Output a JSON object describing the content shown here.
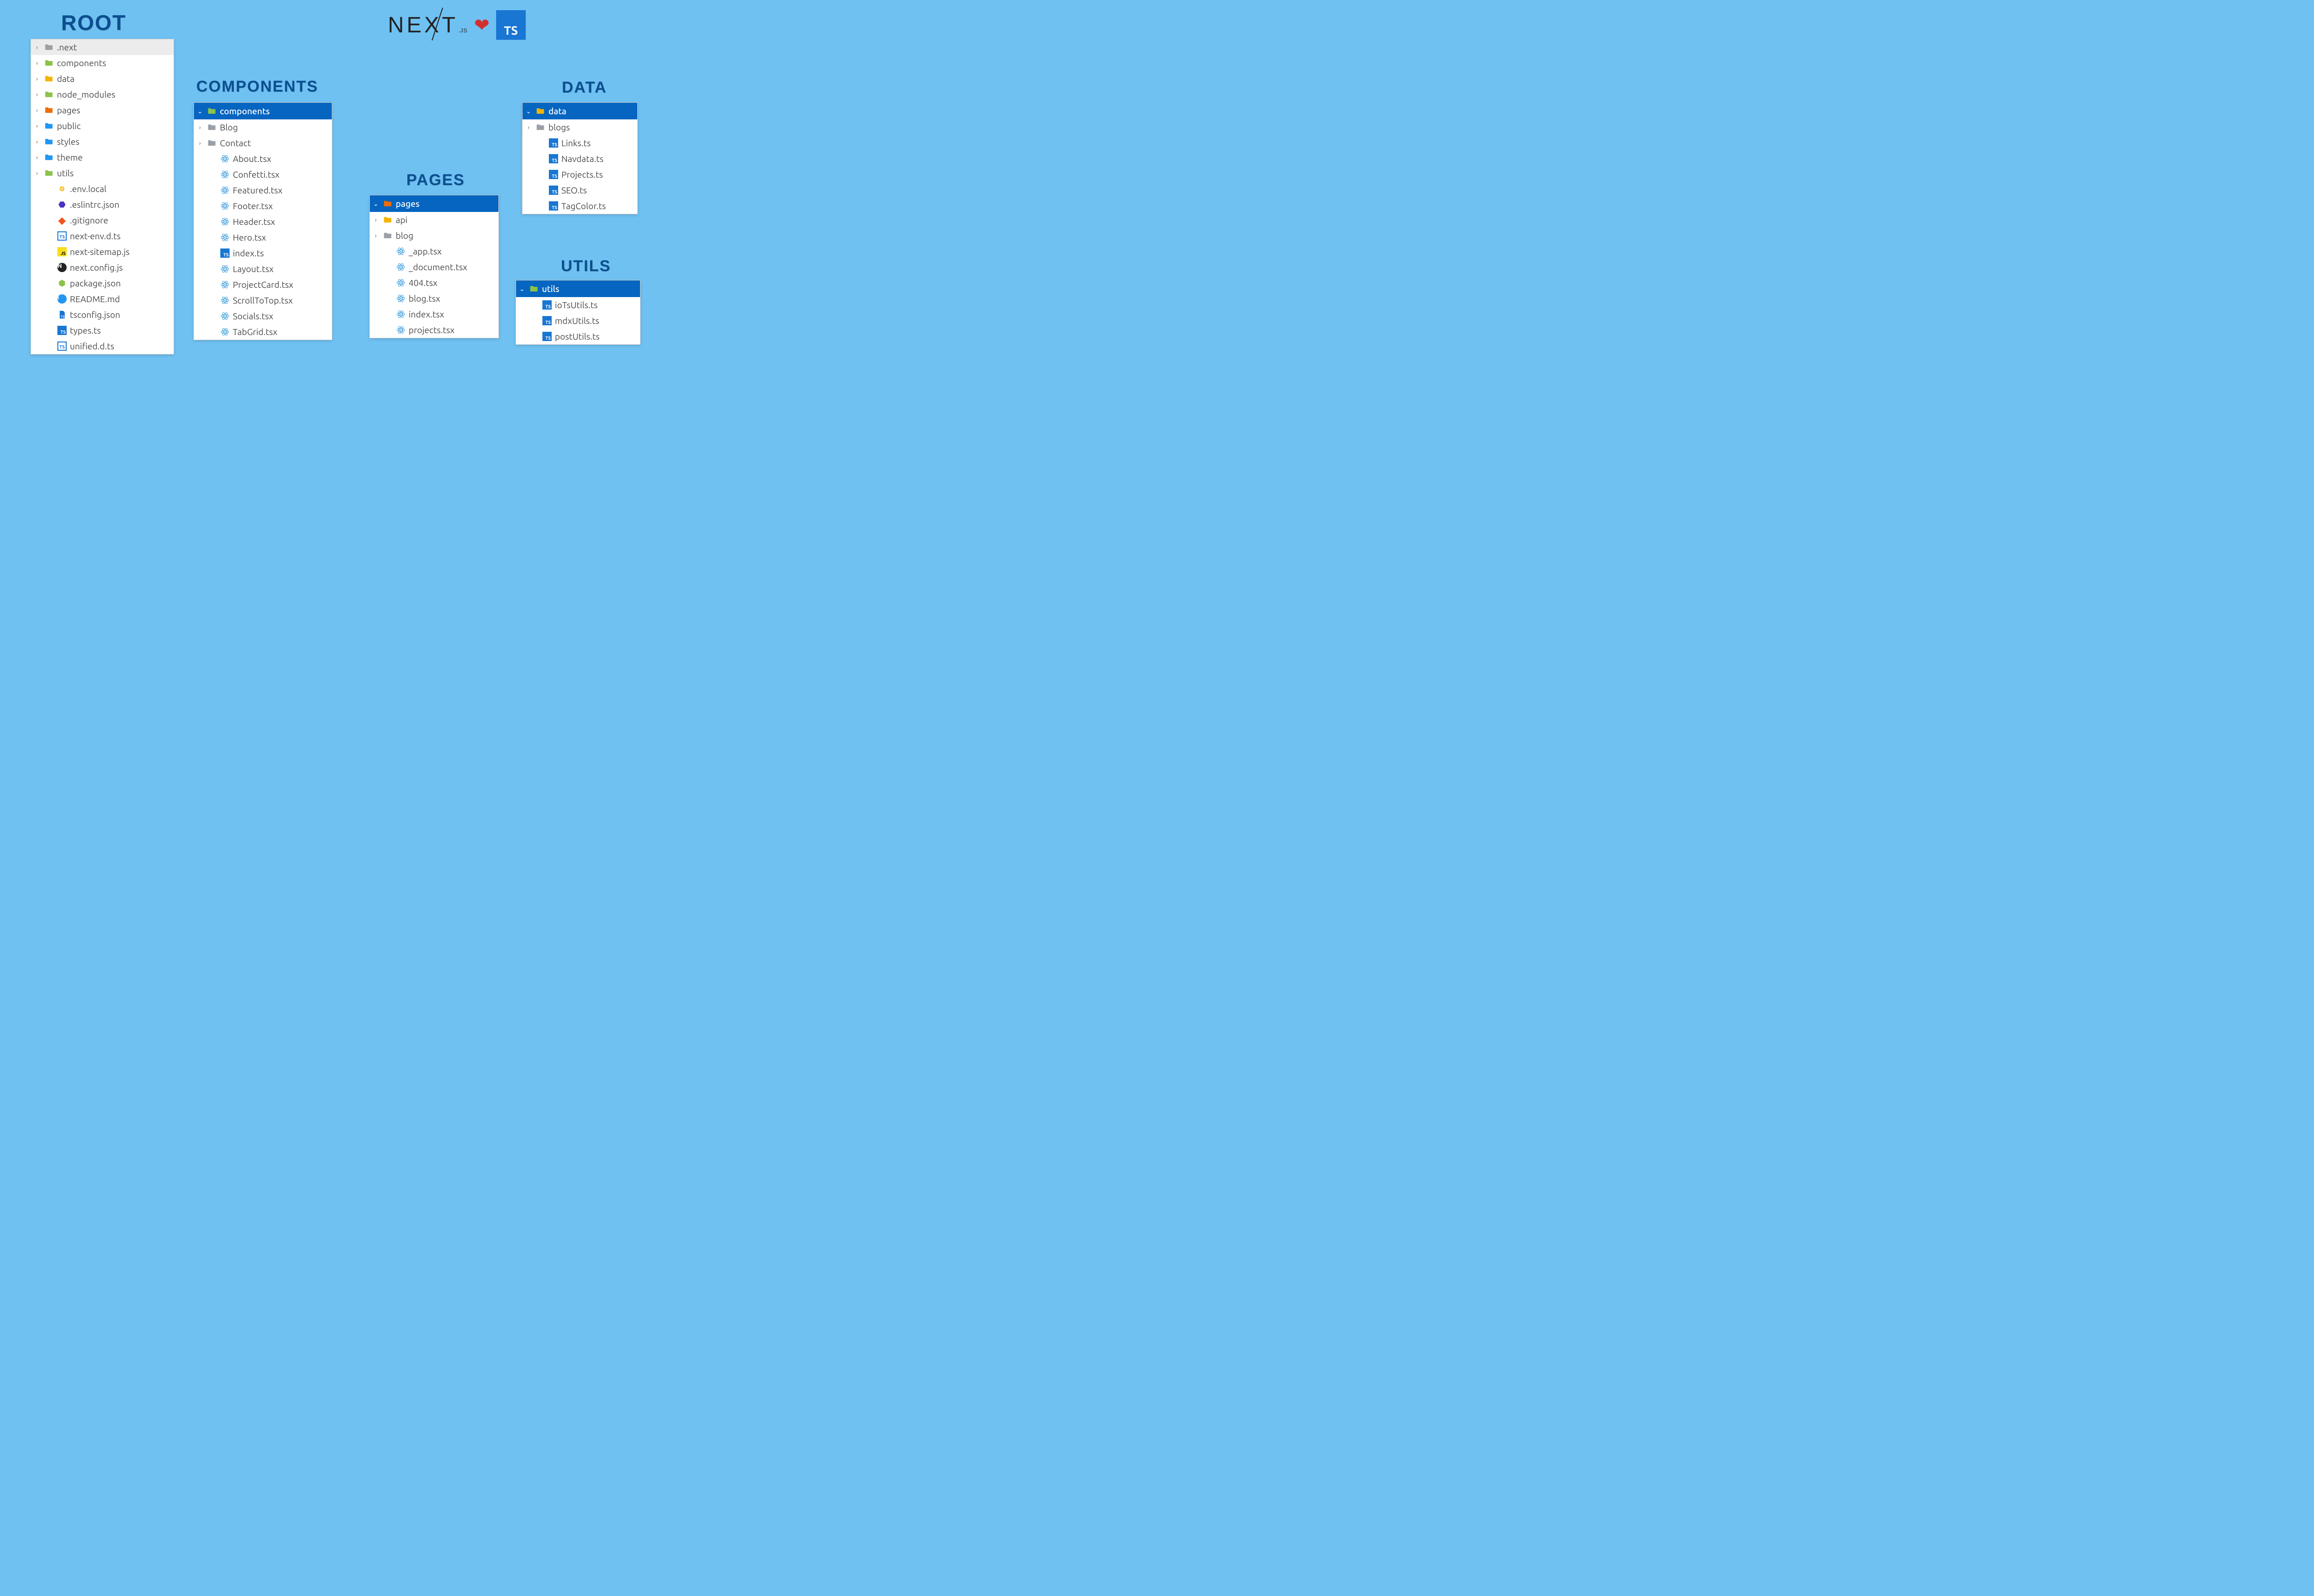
{
  "logos": {
    "next": "NEXT",
    "nextSuffix": ".JS",
    "ts": "TS"
  },
  "root": {
    "title": "ROOT",
    "items": [
      {
        "label": ".next",
        "chev": "right",
        "icon": "folder",
        "indent": 0,
        "selected": true
      },
      {
        "label": "components",
        "chev": "right",
        "icon": "folder-green",
        "indent": 0
      },
      {
        "label": "data",
        "chev": "right",
        "icon": "folder-yellow",
        "indent": 0
      },
      {
        "label": "node_modules",
        "chev": "right",
        "icon": "folder-green",
        "indent": 0
      },
      {
        "label": "pages",
        "chev": "right",
        "icon": "folder-orange",
        "indent": 0
      },
      {
        "label": "public",
        "chev": "right",
        "icon": "folder-blue",
        "indent": 0
      },
      {
        "label": "styles",
        "chev": "right",
        "icon": "folder-blue",
        "indent": 0
      },
      {
        "label": "theme",
        "chev": "right",
        "icon": "folder-blue",
        "indent": 0
      },
      {
        "label": "utils",
        "chev": "right",
        "icon": "folder-green",
        "indent": 0
      },
      {
        "label": ".env.local",
        "chev": "",
        "icon": "env",
        "indent": 1
      },
      {
        "label": ".eslintrc.json",
        "chev": "",
        "icon": "eslint",
        "indent": 1
      },
      {
        "label": ".gitignore",
        "chev": "",
        "icon": "git",
        "indent": 1
      },
      {
        "label": "next-env.d.ts",
        "chev": "",
        "icon": "ts-outline",
        "indent": 1
      },
      {
        "label": "next-sitemap.js",
        "chev": "",
        "icon": "js",
        "indent": 1
      },
      {
        "label": "next.config.js",
        "chev": "",
        "icon": "next",
        "indent": 1
      },
      {
        "label": "package.json",
        "chev": "",
        "icon": "node",
        "indent": 1
      },
      {
        "label": "README.md",
        "chev": "",
        "icon": "info",
        "indent": 1
      },
      {
        "label": "tsconfig.json",
        "chev": "",
        "icon": "tsconf",
        "indent": 1
      },
      {
        "label": "types.ts",
        "chev": "",
        "icon": "ts",
        "indent": 1
      },
      {
        "label": "unified.d.ts",
        "chev": "",
        "icon": "ts-outline",
        "indent": 1
      }
    ]
  },
  "components": {
    "title": "COMPONENTS",
    "header": {
      "label": "components",
      "icon": "folder-green-open"
    },
    "items": [
      {
        "label": "Blog",
        "chev": "right",
        "icon": "folder",
        "indent": 0
      },
      {
        "label": "Contact",
        "chev": "right",
        "icon": "folder",
        "indent": 0
      },
      {
        "label": "About.tsx",
        "chev": "",
        "icon": "react",
        "indent": 1
      },
      {
        "label": "Confetti.tsx",
        "chev": "",
        "icon": "react",
        "indent": 1
      },
      {
        "label": "Featured.tsx",
        "chev": "",
        "icon": "react",
        "indent": 1
      },
      {
        "label": "Footer.tsx",
        "chev": "",
        "icon": "react",
        "indent": 1
      },
      {
        "label": "Header.tsx",
        "chev": "",
        "icon": "react",
        "indent": 1
      },
      {
        "label": "Hero.tsx",
        "chev": "",
        "icon": "react",
        "indent": 1
      },
      {
        "label": "index.ts",
        "chev": "",
        "icon": "ts",
        "indent": 1
      },
      {
        "label": "Layout.tsx",
        "chev": "",
        "icon": "react",
        "indent": 1
      },
      {
        "label": "ProjectCard.tsx",
        "chev": "",
        "icon": "react",
        "indent": 1
      },
      {
        "label": "ScrollToTop.tsx",
        "chev": "",
        "icon": "react",
        "indent": 1
      },
      {
        "label": "Socials.tsx",
        "chev": "",
        "icon": "react",
        "indent": 1
      },
      {
        "label": "TabGrid.tsx",
        "chev": "",
        "icon": "react",
        "indent": 1
      }
    ]
  },
  "pages": {
    "title": "PAGES",
    "header": {
      "label": "pages",
      "icon": "folder-orange-open"
    },
    "items": [
      {
        "label": "api",
        "chev": "right",
        "icon": "folder-yellow",
        "indent": 0
      },
      {
        "label": "blog",
        "chev": "right",
        "icon": "folder",
        "indent": 0
      },
      {
        "label": "_app.tsx",
        "chev": "",
        "icon": "react",
        "indent": 1
      },
      {
        "label": "_document.tsx",
        "chev": "",
        "icon": "react",
        "indent": 1
      },
      {
        "label": "404.tsx",
        "chev": "",
        "icon": "react",
        "indent": 1
      },
      {
        "label": "blog.tsx",
        "chev": "",
        "icon": "react",
        "indent": 1
      },
      {
        "label": "index.tsx",
        "chev": "",
        "icon": "react",
        "indent": 1
      },
      {
        "label": "projects.tsx",
        "chev": "",
        "icon": "react",
        "indent": 1
      }
    ]
  },
  "data": {
    "title": "DATA",
    "header": {
      "label": "data",
      "icon": "folder-yellow-open"
    },
    "items": [
      {
        "label": "blogs",
        "chev": "right",
        "icon": "folder",
        "indent": 0
      },
      {
        "label": "Links.ts",
        "chev": "",
        "icon": "ts",
        "indent": 1
      },
      {
        "label": "Navdata.ts",
        "chev": "",
        "icon": "ts",
        "indent": 1
      },
      {
        "label": "Projects.ts",
        "chev": "",
        "icon": "ts",
        "indent": 1
      },
      {
        "label": "SEO.ts",
        "chev": "",
        "icon": "ts",
        "indent": 1
      },
      {
        "label": "TagColor.ts",
        "chev": "",
        "icon": "ts",
        "indent": 1
      }
    ]
  },
  "utils": {
    "title": "UTILS",
    "header": {
      "label": "utils",
      "icon": "folder-green-open"
    },
    "items": [
      {
        "label": "ioTsUtils.ts",
        "chev": "",
        "icon": "ts",
        "indent": 1
      },
      {
        "label": "mdxUtils.ts",
        "chev": "",
        "icon": "ts",
        "indent": 1
      },
      {
        "label": "postUtils.ts",
        "chev": "",
        "icon": "ts",
        "indent": 1
      }
    ]
  }
}
